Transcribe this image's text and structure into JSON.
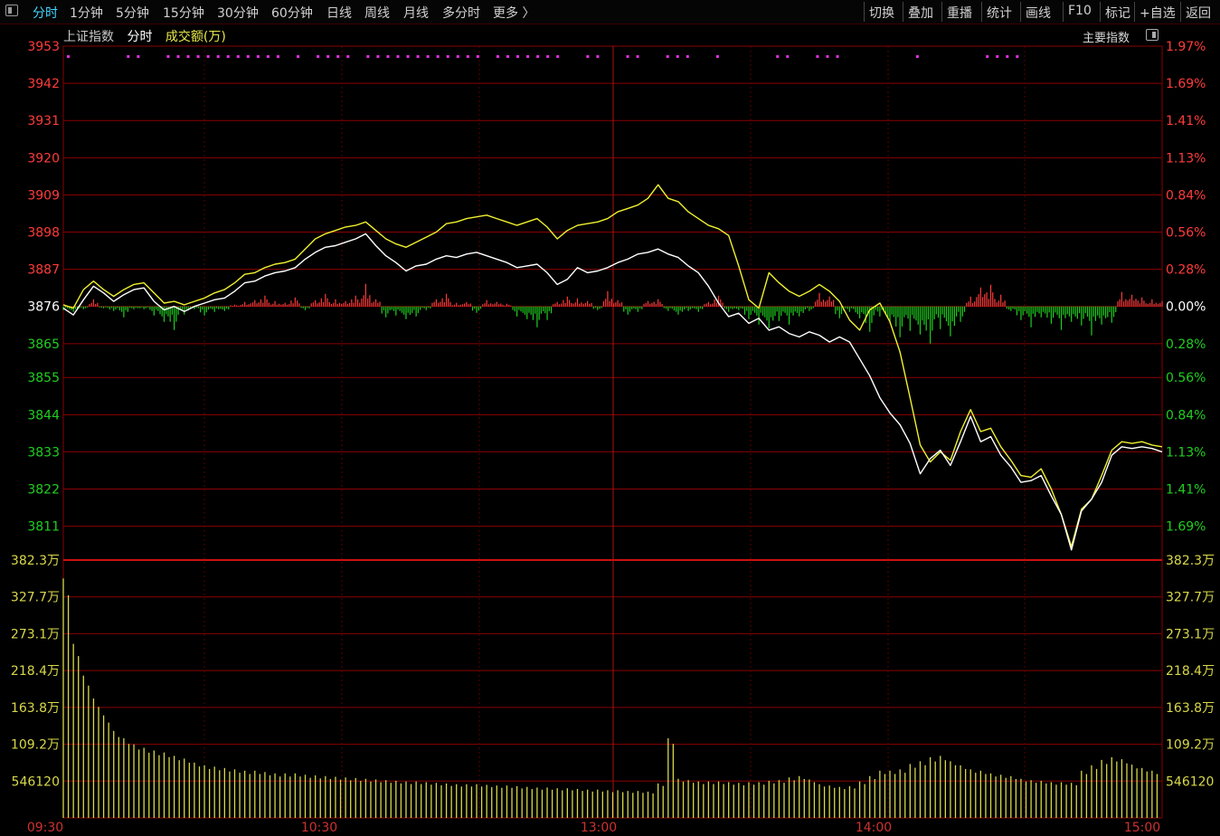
{
  "toolbar": {
    "periods": [
      {
        "label": "分时",
        "active": true
      },
      {
        "label": "1分钟",
        "active": false
      },
      {
        "label": "5分钟",
        "active": false
      },
      {
        "label": "15分钟",
        "active": false
      },
      {
        "label": "30分钟",
        "active": false
      },
      {
        "label": "60分钟",
        "active": false
      },
      {
        "label": "日线",
        "active": false
      },
      {
        "label": "周线",
        "active": false
      },
      {
        "label": "月线",
        "active": false
      },
      {
        "label": "多分时",
        "active": false
      },
      {
        "label": "更多 〉",
        "active": false
      }
    ],
    "actions": [
      "切换",
      "叠加",
      "重播",
      "统计",
      "画线",
      "F10",
      "标记",
      "+自选",
      "返回"
    ]
  },
  "header": {
    "index_name": "上证指数",
    "mode": "分时",
    "metric": "成交额(万)",
    "main_index_button": "主要指数"
  },
  "colors": {
    "up": "#ff3b3b",
    "down": "#1fcf1f",
    "neutral": "#ffffff",
    "index_line": "#ffffff",
    "avg_line": "#f0f030",
    "grid": "#8a0000",
    "volume": "#d8d84a",
    "marker": "#e030e0",
    "active_tab": "#43d7ff"
  },
  "chart_data": {
    "type": "line",
    "prev_close": 3876,
    "price_axis": {
      "ticks": [
        3953,
        3942,
        3931,
        3920,
        3909,
        3898,
        3887,
        3876,
        3865,
        3855,
        3844,
        3833,
        3822,
        3811
      ],
      "ylim": [
        3801,
        3953
      ]
    },
    "pct_axis": [
      "1.97%",
      "1.69%",
      "1.41%",
      "1.13%",
      "0.84%",
      "0.56%",
      "0.28%",
      "0.00%",
      "0.28%",
      "0.56%",
      "0.84%",
      "1.13%",
      "1.41%",
      "1.69%"
    ],
    "volume_axis": {
      "ticks": [
        "382.3万",
        "327.7万",
        "273.1万",
        "218.4万",
        "163.8万",
        "109.2万",
        "546120"
      ],
      "ylim": [
        0,
        382.3
      ],
      "unit": "万"
    },
    "time_labels": [
      "09:30",
      "10:30",
      "13:00",
      "14:00",
      "15:00"
    ],
    "index_line": [
      3875.5,
      3873.5,
      3878,
      3882,
      3880,
      3877.5,
      3879.5,
      3881,
      3881.5,
      3877.5,
      3875,
      3876,
      3874.5,
      3876,
      3877,
      3878,
      3878.5,
      3880.5,
      3883,
      3883.5,
      3885,
      3886,
      3886.5,
      3887.5,
      3890,
      3892,
      3893.5,
      3894,
      3895,
      3896,
      3897.5,
      3894,
      3891,
      3889,
      3886.5,
      3888,
      3888.5,
      3890,
      3891,
      3890.5,
      3891.5,
      3892,
      3891,
      3890,
      3889,
      3887.5,
      3888,
      3888.5,
      3886,
      3882.5,
      3884,
      3887.5,
      3886,
      3886.5,
      3887.5,
      3889,
      3890,
      3891.5,
      3892,
      3893,
      3891.5,
      3890.5,
      3888,
      3886,
      3882,
      3877,
      3873,
      3874,
      3871,
      3872.5,
      3869,
      3870,
      3868,
      3867,
      3868.5,
      3867.5,
      3865.5,
      3867,
      3865.5,
      3860.5,
      3855.5,
      3849,
      3844.5,
      3841,
      3835.5,
      3826.5,
      3831,
      3833.5,
      3829,
      3836,
      3843.5,
      3836,
      3837.5,
      3832,
      3828.5,
      3824,
      3824.5,
      3826,
      3820,
      3814.5,
      3804,
      3815.5,
      3819,
      3824,
      3832,
      3834.5,
      3834,
      3834.5,
      3834,
      3833
    ],
    "avg_line": [
      3876.5,
      3875.5,
      3881,
      3883.5,
      3881,
      3879,
      3881,
      3882.5,
      3883,
      3880,
      3877,
      3877.5,
      3876.5,
      3877.5,
      3878.5,
      3880,
      3881,
      3883,
      3885.5,
      3886,
      3887.5,
      3888.5,
      3889,
      3890,
      3893,
      3896,
      3897.5,
      3898.5,
      3899.5,
      3900,
      3901,
      3898.5,
      3896,
      3894.5,
      3893.5,
      3895,
      3896.5,
      3898,
      3900.5,
      3901,
      3902,
      3902.5,
      3903,
      3902,
      3901,
      3900,
      3901,
      3902,
      3899.5,
      3896,
      3898.5,
      3900,
      3900.5,
      3901,
      3902,
      3904,
      3905,
      3906,
      3908,
      3912,
      3908,
      3907,
      3904,
      3902,
      3900,
      3899,
      3897,
      3888,
      3878,
      3875.5,
      3886,
      3883,
      3880.5,
      3879,
      3880.5,
      3882.5,
      3880.5,
      3877.5,
      3872,
      3869,
      3875,
      3877,
      3871.5,
      3862.5,
      3849,
      3835,
      3830,
      3833,
      3830.5,
      3839,
      3845.5,
      3839,
      3840,
      3834.5,
      3830.5,
      3826,
      3825.5,
      3828,
      3822,
      3814.5,
      3805,
      3816,
      3819,
      3826,
      3833.5,
      3836,
      3835.5,
      3836,
      3835,
      3834.5
    ],
    "breadth_bars": [
      -4,
      -6,
      -3,
      8,
      -2,
      -5,
      -12,
      -3,
      -3,
      -10,
      -17,
      -26,
      -9,
      -3,
      -10,
      -6,
      -5,
      2,
      5,
      7,
      12,
      6,
      4,
      10,
      -4,
      7,
      14,
      8,
      6,
      12,
      25,
      8,
      -12,
      -10,
      -14,
      -11,
      -4,
      8,
      14,
      4,
      5,
      -7,
      7,
      5,
      3,
      -11,
      -14,
      -23,
      -15,
      5,
      11,
      9,
      6,
      -4,
      17,
      7,
      -9,
      -6,
      6,
      8,
      -5,
      -9,
      -5,
      -6,
      5,
      12,
      -6,
      -4,
      -14,
      -20,
      -24,
      -16,
      -20,
      -11,
      -5,
      15,
      11,
      -13,
      -6,
      -13,
      -28,
      -11,
      -18,
      -34,
      -27,
      -31,
      -41,
      -25,
      -33,
      -17,
      11,
      21,
      24,
      13,
      -5,
      -15,
      -23,
      -12,
      -19,
      -26,
      -17,
      -21,
      -32,
      -20,
      -18,
      16,
      13,
      10,
      8,
      6
    ],
    "volume_values": [
      355,
      258,
      211,
      177,
      152,
      129,
      118,
      109,
      104,
      100,
      97,
      92,
      88,
      82,
      78,
      76,
      74,
      72,
      70,
      70,
      68,
      66,
      66,
      66,
      64,
      63,
      62,
      61,
      60,
      59,
      58,
      57,
      56,
      55,
      54,
      54,
      53,
      52,
      51,
      50,
      50,
      50,
      49,
      48,
      48,
      47,
      46,
      45,
      45,
      44,
      44,
      43,
      42,
      42,
      41,
      41,
      40,
      40,
      39,
      51,
      118,
      58,
      56,
      54,
      54,
      54,
      53,
      52,
      53,
      53,
      55,
      56,
      60,
      62,
      57,
      50,
      48,
      46,
      47,
      54,
      62,
      70,
      70,
      72,
      80,
      84,
      90,
      92,
      84,
      78,
      72,
      70,
      66,
      64,
      62,
      58,
      56,
      55,
      53,
      53,
      52,
      70,
      78,
      86,
      90,
      87,
      79,
      74,
      70,
      67
    ],
    "markers": [
      0,
      6,
      7,
      10,
      11,
      12,
      13,
      14,
      15,
      16,
      17,
      18,
      19,
      20,
      21,
      23,
      25,
      26,
      27,
      28,
      30,
      31,
      32,
      33,
      34,
      35,
      36,
      37,
      38,
      39,
      40,
      41,
      43,
      44,
      45,
      46,
      47,
      48,
      49,
      52,
      53,
      56,
      57,
      60,
      61,
      62,
      65,
      71,
      72,
      75,
      76,
      77,
      85,
      92,
      93,
      94,
      95
    ]
  }
}
